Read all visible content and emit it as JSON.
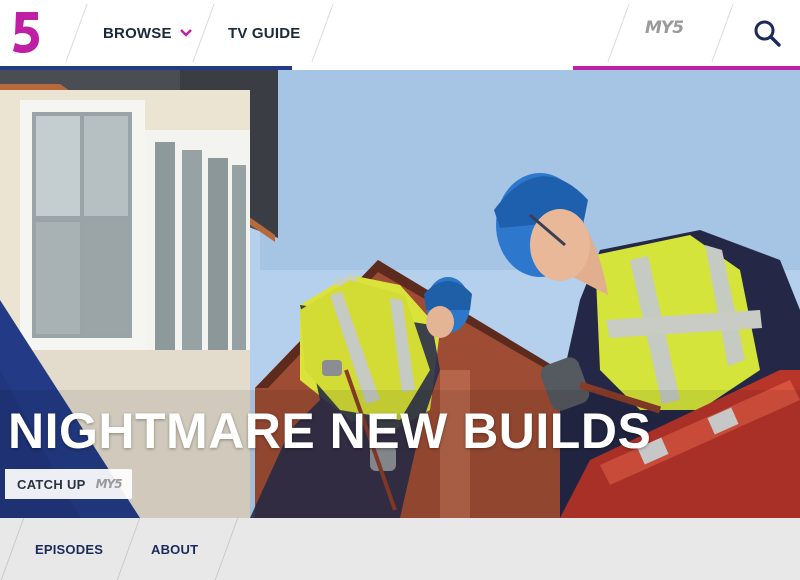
{
  "header": {
    "logo_text": "5",
    "nav": {
      "browse_label": "BROWSE",
      "tv_guide_label": "TV GUIDE"
    },
    "my5_label": "MY5",
    "colors": {
      "logo": "#bf1fa4",
      "nav_text": "#1b2a3a",
      "accent_blue": "#233b86",
      "accent_magenta": "#bf1fa4"
    }
  },
  "hero": {
    "title": "NIGHTMARE NEW BUILDS",
    "catchup_label": "CATCH UP",
    "catchup_my5": "MY5"
  },
  "tabs": [
    {
      "label": "EPISODES"
    },
    {
      "label": "ABOUT"
    }
  ]
}
